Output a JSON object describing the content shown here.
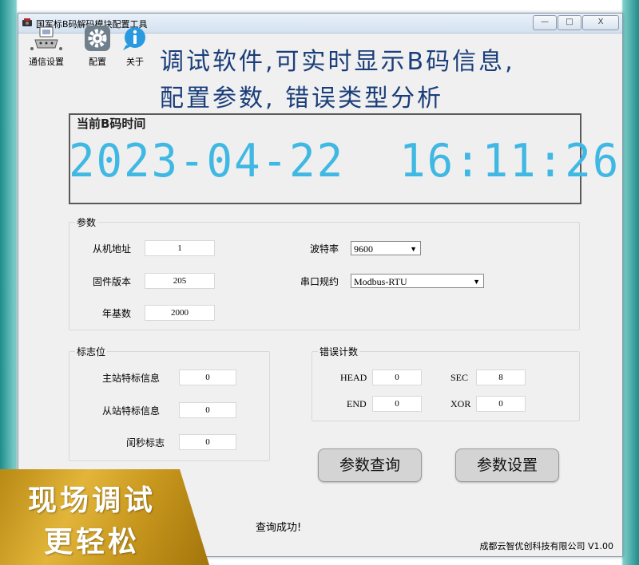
{
  "window": {
    "title": "国军标B码解码模块配置工具",
    "min": "—",
    "max": "□",
    "close": "X"
  },
  "toolbar": [
    {
      "label": "通信设置",
      "icon": "serial-port-icon"
    },
    {
      "label": "配置",
      "icon": "gear-icon"
    },
    {
      "label": "关于",
      "icon": "info-icon"
    }
  ],
  "overlay": {
    "line1": "调试软件,可实时显示B码信息,",
    "line2": "配置参数, 错误类型分析"
  },
  "clock": {
    "title": "当前B码时间",
    "time": "2023-04-22  16:11:26"
  },
  "params": {
    "title": "参数",
    "slave_addr_label": "从机地址",
    "slave_addr": "1",
    "firmware_label": "固件版本",
    "firmware": "205",
    "year_base_label": "年基数",
    "year_base": "2000",
    "baud_label": "波特率",
    "baud": "9600",
    "protocol_label": "串口规约",
    "protocol": "Modbus-RTU"
  },
  "flags": {
    "title": "标志位",
    "master_label": "主站特标信息",
    "master": "0",
    "slave_label": "从站特标信息",
    "slave": "0",
    "leap_label": "闰秒标志",
    "leap": "0"
  },
  "errors": {
    "title": "错误计数",
    "head_label": "HEAD",
    "head": "0",
    "sec_label": "SEC",
    "sec": "8",
    "end_label": "END",
    "end": "0",
    "xor_label": "XOR",
    "xor": "0"
  },
  "buttons": {
    "query": "参数查询",
    "set": "参数设置"
  },
  "status": "查询成功!",
  "company": "成都云智优创科技有限公司 V1.00",
  "banner": {
    "line1": "现场调试",
    "line2": "更轻松"
  },
  "colors": {
    "clock_digits": "#3fb8e3",
    "overlay_text": "#1b3e7a",
    "banner_gold": "#d4a52c"
  }
}
